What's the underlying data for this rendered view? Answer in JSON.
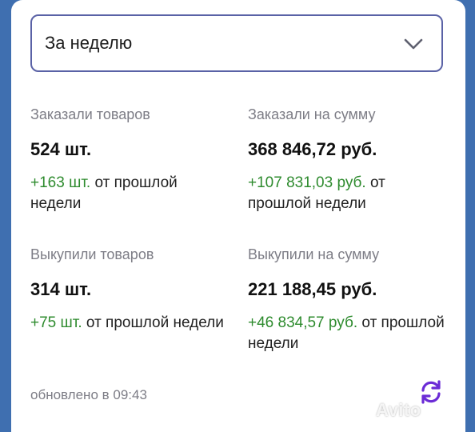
{
  "period_select": {
    "value": "За неделю",
    "icon": "chevron-down-icon"
  },
  "stats": [
    {
      "label": "Заказали товаров",
      "value": "524 шт.",
      "delta_value": "+163 шт.",
      "delta_suffix": " от прошлой недели"
    },
    {
      "label": "Заказали на сумму",
      "value": "368 846,72 руб.",
      "delta_value": "+107 831,03 руб.",
      "delta_suffix": " от прошлой недели"
    },
    {
      "label": "Выкупили товаров",
      "value": "314 шт.",
      "delta_value": "+75 шт.",
      "delta_suffix": " от прошлой недели"
    },
    {
      "label": "Выкупили на сумму",
      "value": "221 188,45 руб.",
      "delta_value": "+46 834,57 руб.",
      "delta_suffix": " от прошлой недели"
    }
  ],
  "footer": {
    "updated": "обновлено в 09:43",
    "refresh_icon": "refresh-icon"
  },
  "watermark": "Avito",
  "colors": {
    "accent": "#5a62a6",
    "positive": "#2e8b2e",
    "muted": "#7d7d86",
    "refresh": "#6b2bd6"
  }
}
